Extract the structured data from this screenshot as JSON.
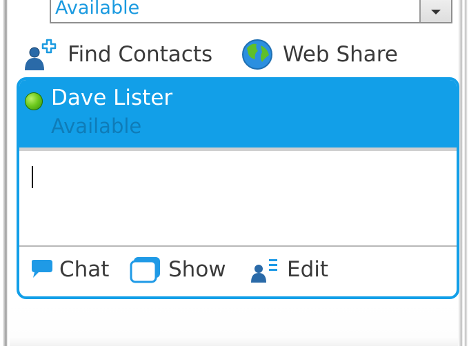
{
  "status_selector": {
    "value": "Available"
  },
  "toolbar": {
    "find_contacts": "Find Contacts",
    "web_share": "Web Share"
  },
  "contact": {
    "name": "Dave Lister",
    "status": "Available",
    "message_input": ""
  },
  "actions": {
    "chat": "Chat",
    "show": "Show",
    "edit": "Edit"
  },
  "colors": {
    "accent": "#129fe8",
    "presence_available": "#6cc81c"
  },
  "icons": {
    "find_contacts": "add-contact-icon",
    "web_share": "globe-icon",
    "chat": "speech-bubble-icon",
    "show": "window-icon",
    "edit": "contact-edit-icon"
  }
}
